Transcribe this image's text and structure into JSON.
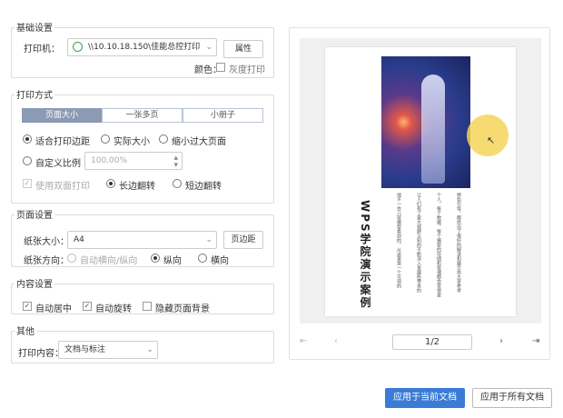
{
  "basic": {
    "title": "基础设置",
    "printer_label": "打印机：",
    "printer_value": "\\\\10.10.18.150\\佳能总控打印",
    "properties_button": "属性",
    "color_label": "颜色：",
    "grayscale_label": "灰度打印"
  },
  "print_mode": {
    "title": "打印方式",
    "tabs": [
      "页面大小",
      "一张多页",
      "小册子"
    ],
    "fit_margins": "适合打印边距",
    "actual_size": "实际大小",
    "shrink_large": "缩小过大页面",
    "custom_scale": "自定义比例",
    "scale_value": "100.00%",
    "duplex": "使用双面打印",
    "long_edge": "长边翻转",
    "short_edge": "短边翻转"
  },
  "page_setup": {
    "title": "页面设置",
    "paper_size_label": "纸张大小：",
    "paper_size_value": "A4",
    "margins_button": "页边距",
    "orientation_label": "纸张方向：",
    "auto_orientation": "自动横向/纵向",
    "portrait": "纵向",
    "landscape": "横向"
  },
  "content": {
    "title": "内容设置",
    "auto_center": "自动居中",
    "auto_rotate": "自动旋转",
    "hide_background": "隐藏页面背景"
  },
  "other": {
    "title": "其他",
    "print_content_label": "打印内容：",
    "print_content_value": "文档与标注"
  },
  "preview": {
    "doc_title": "WPS学院演示案例",
    "body_col1": "他不一会儿就模型看到的，从这里是一个可观的",
    "body_col2": "让人们有了更大视野认知的不断深入发展所带来的",
    "body_col3": "个人，每个数据，每个模型的存储和管理都会变得更",
    "body_col4": "特色引导，都给出了很好的解读和展示供大家参考",
    "page_indicator": "1/2",
    "first_icon": "first-page-icon",
    "prev_icon": "prev-page-icon",
    "next_icon": "next-page-icon",
    "last_icon": "last-page-icon"
  },
  "actions": {
    "apply_current": "应用于当前文档",
    "apply_all": "应用于所有文档"
  },
  "colors": {
    "primary": "#3a7bd5",
    "tab_active": "#8c9ab3",
    "cursor_highlight": "#f5d55a"
  }
}
